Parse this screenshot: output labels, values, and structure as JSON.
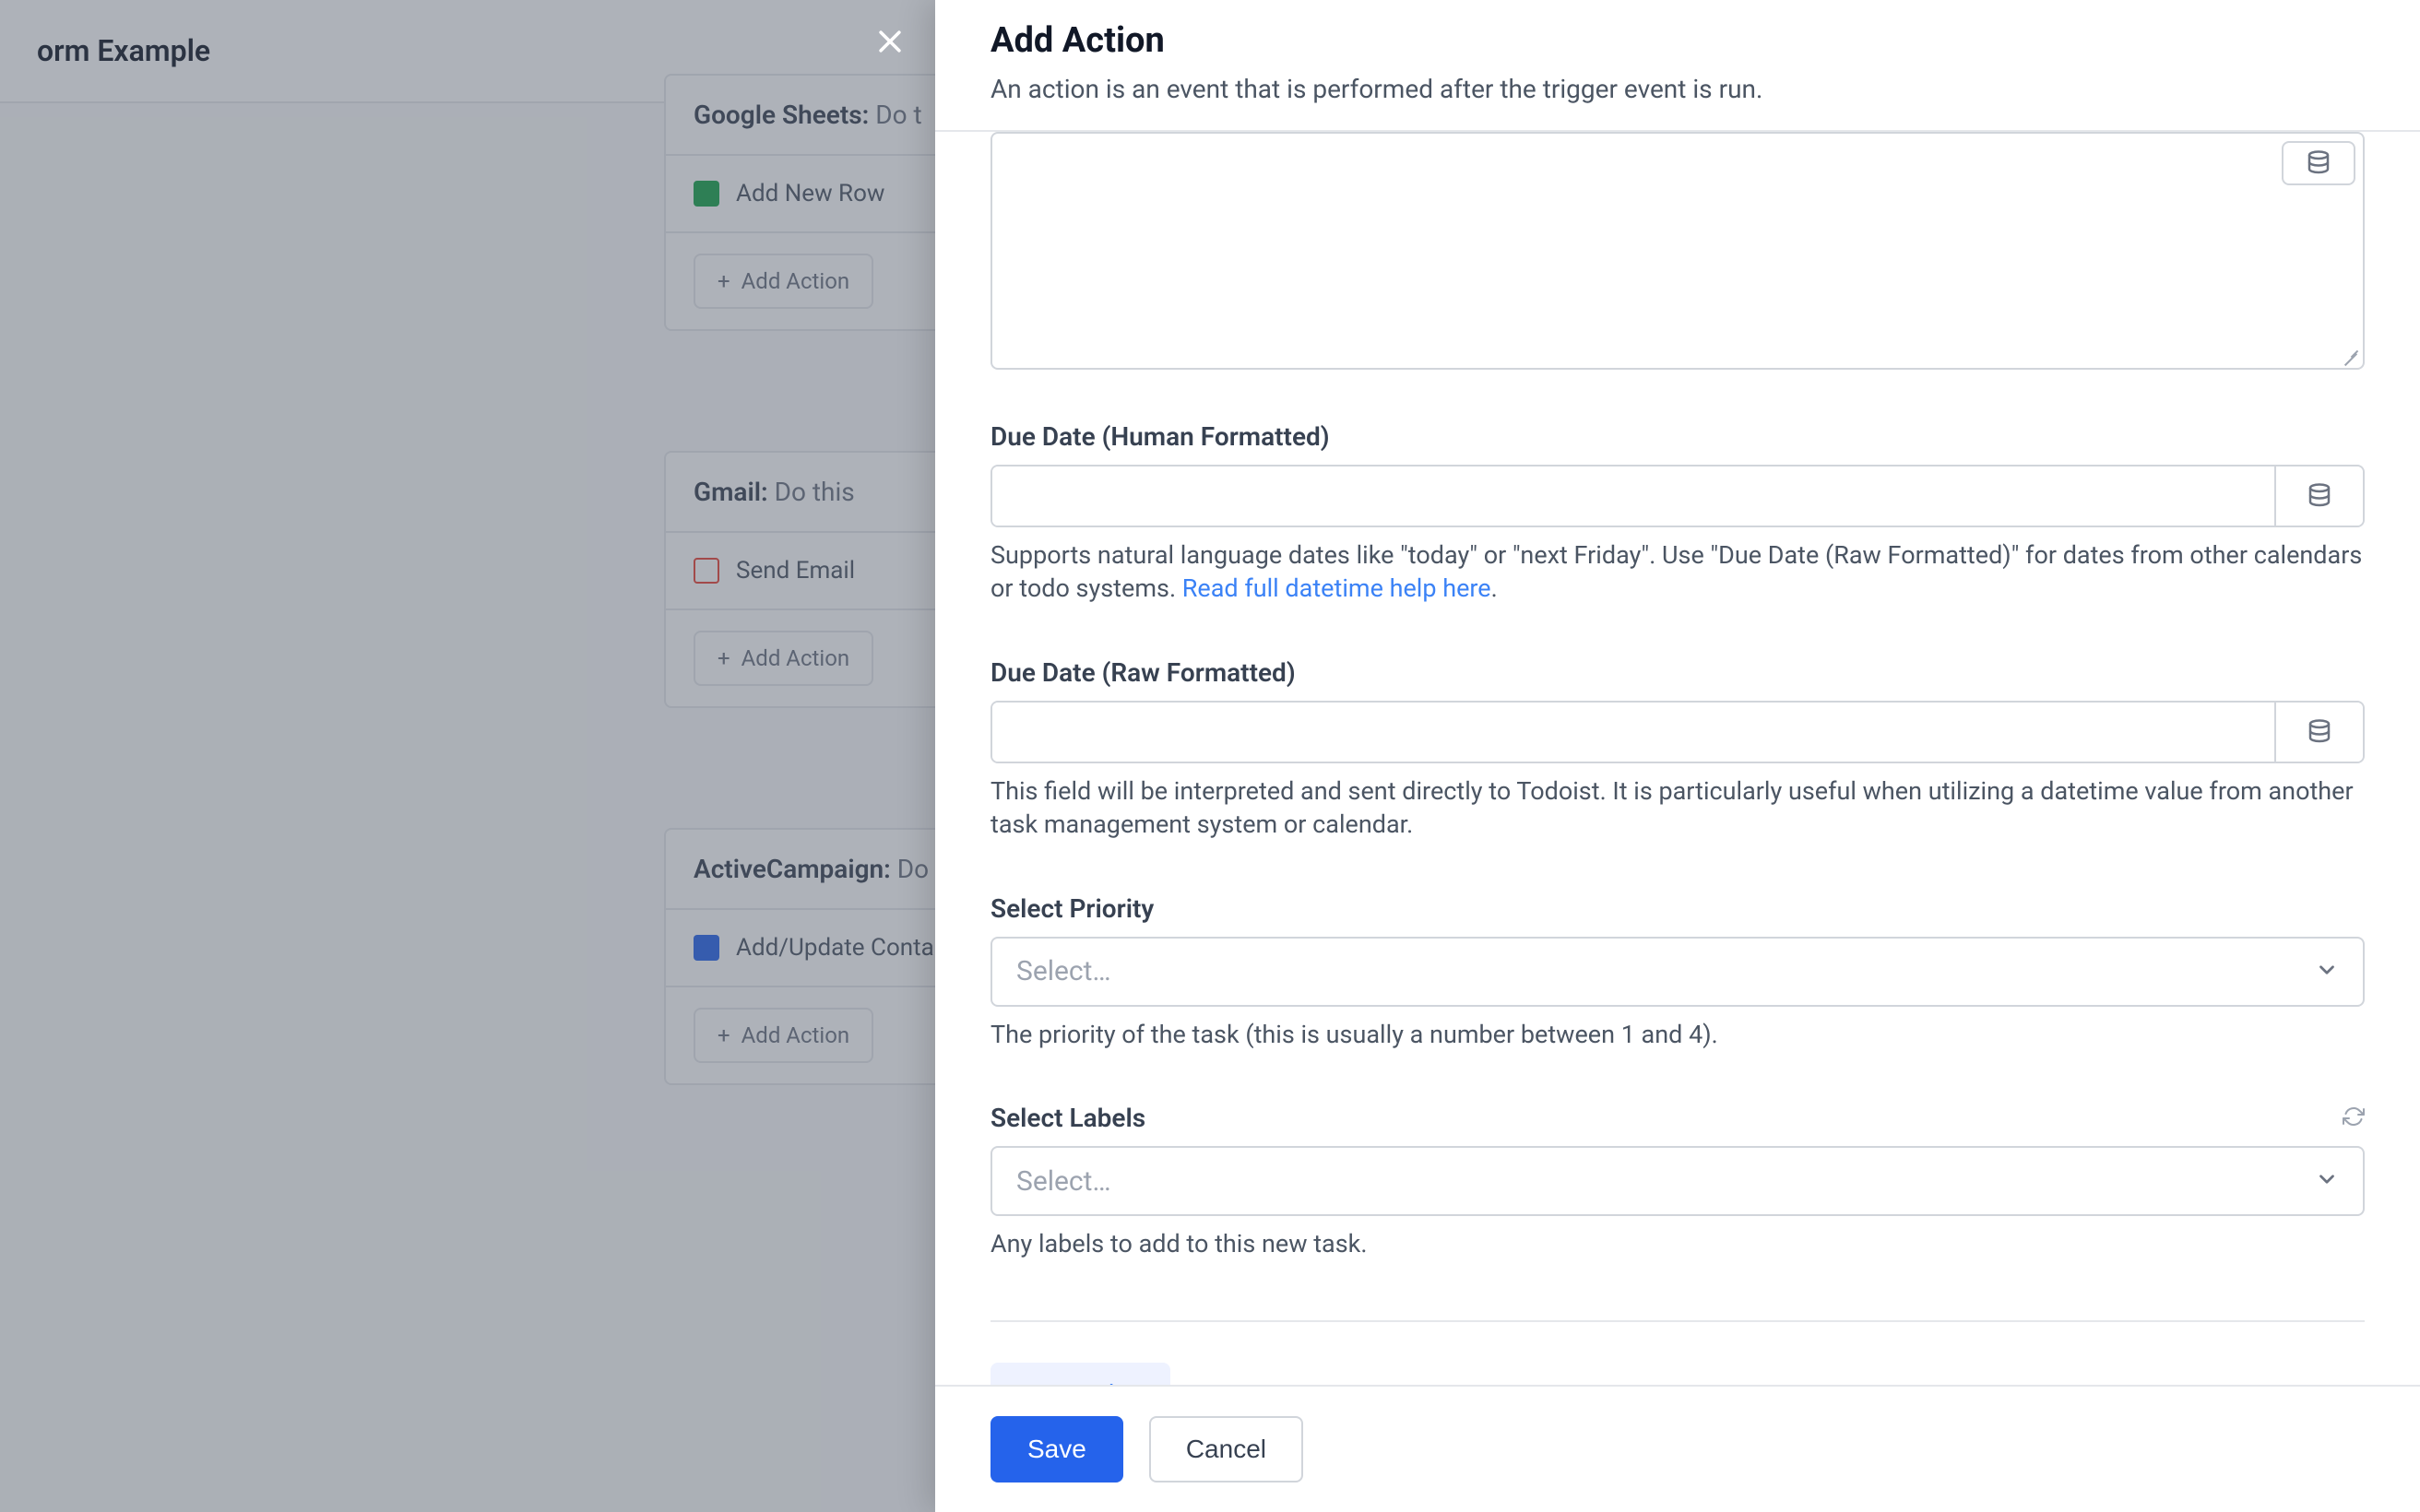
{
  "bg": {
    "header_title": "orm Example",
    "add_action_label": "Add Action",
    "cards": [
      {
        "title": "Google Sheets:",
        "subtitle": "Do t",
        "row": "Add New Row",
        "icon_color": "#16a34a"
      },
      {
        "title": "Gmail:",
        "subtitle": "Do this",
        "row": "Send Email",
        "icon_color": "#ea4335"
      },
      {
        "title": "ActiveCampaign:",
        "subtitle": "Do",
        "row": "Add/Update Conta",
        "icon_color": "#2563eb"
      }
    ]
  },
  "panel": {
    "title": "Add Action",
    "subtitle": "An action is an event that is performed after the trigger event is run.",
    "fields": {
      "due_human": {
        "label": "Due Date (Human Formatted)",
        "help_pre": "Supports natural language dates like \"today\" or \"next Friday\". Use \"Due Date (Raw Formatted)\" for dates from other calendars or todo systems. ",
        "help_link": "Read full datetime help here",
        "help_post": "."
      },
      "due_raw": {
        "label": "Due Date (Raw Formatted)",
        "help": "This field will be interpreted and sent directly to Todoist. It is particularly useful when utilizing a datetime value from another task management system or calendar."
      },
      "priority": {
        "label": "Select Priority",
        "placeholder": "Select…",
        "help": "The priority of the task (this is usually a number between 1 and 4)."
      },
      "labels": {
        "label": "Select Labels",
        "placeholder": "Select…",
        "help": "Any labels to add to this new task."
      }
    },
    "test_button": "Test Action",
    "save": "Save",
    "cancel": "Cancel"
  }
}
